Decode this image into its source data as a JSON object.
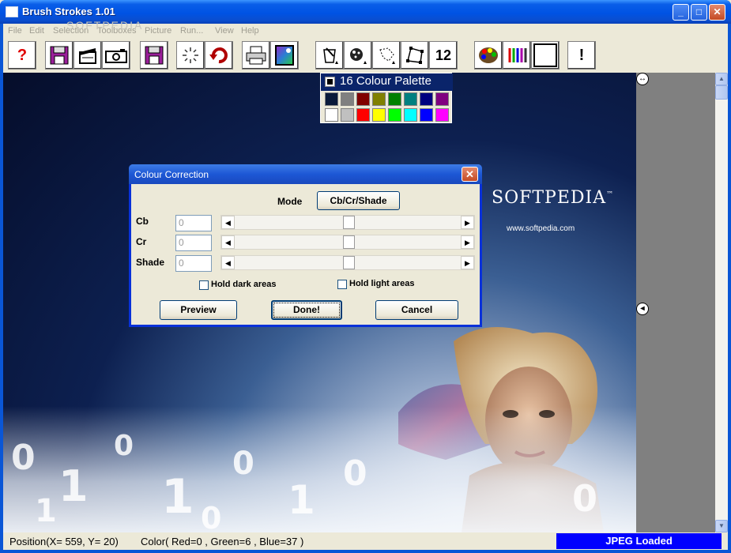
{
  "window": {
    "title": "Brush Strokes  1.01",
    "controls": {
      "minimize": "_",
      "maximize": "□",
      "close": "✕"
    }
  },
  "menu": [
    "File",
    "Edit",
    "Selection",
    "Toolboxes",
    "Picture",
    "Run...",
    "View",
    "Help"
  ],
  "watermark": "SOFTPEDIA",
  "toolbar": {
    "items": [
      {
        "name": "help-button",
        "icon": "help-icon",
        "glyph": "?"
      },
      {
        "name": "save-button",
        "icon": "floppy-icon",
        "glyph": ""
      },
      {
        "name": "film-button",
        "icon": "clapboard-icon",
        "glyph": ""
      },
      {
        "name": "camera-button",
        "icon": "camera-icon",
        "glyph": ""
      },
      {
        "name": "save-as-button",
        "icon": "floppy-icon",
        "glyph": ""
      },
      {
        "name": "sparkle-button",
        "icon": "sparkle-icon",
        "glyph": ""
      },
      {
        "name": "undo-button",
        "icon": "undo-arrow-icon",
        "glyph": ""
      },
      {
        "name": "print-button",
        "icon": "printer-icon",
        "glyph": ""
      },
      {
        "name": "picture-button",
        "icon": "picture-icon",
        "glyph": ""
      },
      {
        "name": "paint-tool-button",
        "icon": "paint-can-icon",
        "glyph": ""
      },
      {
        "name": "spray-tool-button",
        "icon": "spray-icon",
        "glyph": ""
      },
      {
        "name": "lasso-tool-button",
        "icon": "lasso-icon",
        "glyph": ""
      },
      {
        "name": "shape-tool-button",
        "icon": "polygon-icon",
        "glyph": ""
      },
      {
        "name": "brush-size-button",
        "icon": "brush-size-icon",
        "glyph": "12"
      },
      {
        "name": "palette-button",
        "icon": "artist-palette-icon",
        "glyph": ""
      },
      {
        "name": "pencils-button",
        "icon": "pencils-icon",
        "glyph": ""
      },
      {
        "name": "colour-swatch-button",
        "icon": "swatch-icon",
        "glyph": ""
      },
      {
        "name": "alert-button",
        "icon": "exclamation-icon",
        "glyph": "!"
      }
    ]
  },
  "palette": {
    "title": "16 Colour Palette",
    "colors": [
      "#0a1a3a",
      "#808080",
      "#800000",
      "#808000",
      "#008000",
      "#008080",
      "#000080",
      "#800080",
      "#ffffff",
      "#c0c0c0",
      "#ff0000",
      "#ffff00",
      "#00ff00",
      "#00ffff",
      "#0000ff",
      "#ff00ff"
    ]
  },
  "dialog": {
    "title": "Colour Correction",
    "mode_label": "Mode",
    "mode_button": "Cb/Cr/Shade",
    "rows": [
      {
        "label": "Cb",
        "value": "0",
        "level": 0.5
      },
      {
        "label": "Cr",
        "value": "0",
        "level": 0.5
      },
      {
        "label": "Shade",
        "value": "0",
        "level": 0.5
      }
    ],
    "hold_dark": "Hold dark areas",
    "hold_light": "Hold light areas",
    "preview": "Preview",
    "done": "Done!",
    "cancel": "Cancel"
  },
  "canvas": {
    "logo": "SOFTPEDIA",
    "tm": "™",
    "url": "www.softpedia.com"
  },
  "status": {
    "position": "Position(X= 559, Y=  20)",
    "color": "Color( Red=0 , Green=6 , Blue=37 )",
    "message": "JPEG Loaded"
  }
}
